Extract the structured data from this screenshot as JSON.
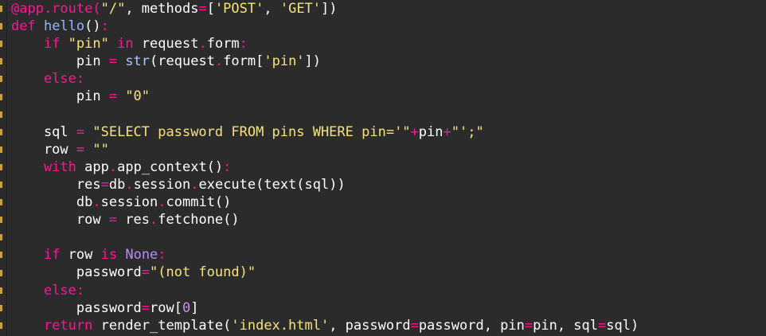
{
  "lines": [
    [
      {
        "cls": "dec",
        "t": "@app.route("
      },
      {
        "cls": "str",
        "t": "\"/\""
      },
      {
        "cls": "plain",
        "t": ", methods"
      },
      {
        "cls": "op",
        "t": "="
      },
      {
        "cls": "plain",
        "t": "["
      },
      {
        "cls": "str",
        "t": "'POST'"
      },
      {
        "cls": "plain",
        "t": ", "
      },
      {
        "cls": "str",
        "t": "'GET'"
      },
      {
        "cls": "plain",
        "t": "])"
      }
    ],
    [
      {
        "cls": "kw",
        "t": "def "
      },
      {
        "cls": "fn",
        "t": "hello"
      },
      {
        "cls": "plain",
        "t": "()"
      },
      {
        "cls": "op",
        "t": ":"
      }
    ],
    [
      {
        "cls": "plain",
        "t": "    "
      },
      {
        "cls": "kw",
        "t": "if "
      },
      {
        "cls": "str",
        "t": "\"pin\""
      },
      {
        "cls": "kw",
        "t": " in "
      },
      {
        "cls": "plain",
        "t": "request"
      },
      {
        "cls": "op",
        "t": "."
      },
      {
        "cls": "plain",
        "t": "form"
      },
      {
        "cls": "op",
        "t": ":"
      }
    ],
    [
      {
        "cls": "plain",
        "t": "        pin "
      },
      {
        "cls": "op",
        "t": "="
      },
      {
        "cls": "bi",
        "t": " str"
      },
      {
        "cls": "plain",
        "t": "(request"
      },
      {
        "cls": "op",
        "t": "."
      },
      {
        "cls": "plain",
        "t": "form["
      },
      {
        "cls": "str",
        "t": "'pin'"
      },
      {
        "cls": "plain",
        "t": "])"
      }
    ],
    [
      {
        "cls": "plain",
        "t": "    "
      },
      {
        "cls": "kw",
        "t": "else"
      },
      {
        "cls": "op",
        "t": ":"
      }
    ],
    [
      {
        "cls": "plain",
        "t": "        pin "
      },
      {
        "cls": "op",
        "t": "="
      },
      {
        "cls": "str",
        "t": " \"0\""
      }
    ],
    [],
    [
      {
        "cls": "plain",
        "t": "    sql "
      },
      {
        "cls": "op",
        "t": "="
      },
      {
        "cls": "str",
        "t": " \"SELECT password FROM pins WHERE pin='\""
      },
      {
        "cls": "op",
        "t": "+"
      },
      {
        "cls": "plain",
        "t": "pin"
      },
      {
        "cls": "op",
        "t": "+"
      },
      {
        "cls": "str",
        "t": "\"';\""
      }
    ],
    [
      {
        "cls": "plain",
        "t": "    row "
      },
      {
        "cls": "op",
        "t": "="
      },
      {
        "cls": "str",
        "t": " \"\""
      }
    ],
    [
      {
        "cls": "plain",
        "t": "    "
      },
      {
        "cls": "kw",
        "t": "with"
      },
      {
        "cls": "plain",
        "t": " app"
      },
      {
        "cls": "op",
        "t": "."
      },
      {
        "cls": "plain",
        "t": "app_context()"
      },
      {
        "cls": "op",
        "t": ":"
      }
    ],
    [
      {
        "cls": "plain",
        "t": "        res"
      },
      {
        "cls": "op",
        "t": "="
      },
      {
        "cls": "plain",
        "t": "db"
      },
      {
        "cls": "op",
        "t": "."
      },
      {
        "cls": "plain",
        "t": "session"
      },
      {
        "cls": "op",
        "t": "."
      },
      {
        "cls": "plain",
        "t": "execute(text(sql))"
      }
    ],
    [
      {
        "cls": "plain",
        "t": "        db"
      },
      {
        "cls": "op",
        "t": "."
      },
      {
        "cls": "plain",
        "t": "session"
      },
      {
        "cls": "op",
        "t": "."
      },
      {
        "cls": "plain",
        "t": "commit()"
      }
    ],
    [
      {
        "cls": "plain",
        "t": "        row "
      },
      {
        "cls": "op",
        "t": "="
      },
      {
        "cls": "plain",
        "t": " res"
      },
      {
        "cls": "op",
        "t": "."
      },
      {
        "cls": "plain",
        "t": "fetchone()"
      }
    ],
    [],
    [
      {
        "cls": "plain",
        "t": "    "
      },
      {
        "cls": "kw",
        "t": "if"
      },
      {
        "cls": "plain",
        "t": " row "
      },
      {
        "cls": "kw",
        "t": "is"
      },
      {
        "cls": "const",
        "t": " None"
      },
      {
        "cls": "op",
        "t": ":"
      }
    ],
    [
      {
        "cls": "plain",
        "t": "        password"
      },
      {
        "cls": "op",
        "t": "="
      },
      {
        "cls": "str",
        "t": "\"(not found)\""
      }
    ],
    [
      {
        "cls": "plain",
        "t": "    "
      },
      {
        "cls": "kw",
        "t": "else"
      },
      {
        "cls": "op",
        "t": ":"
      }
    ],
    [
      {
        "cls": "plain",
        "t": "        password"
      },
      {
        "cls": "op",
        "t": "="
      },
      {
        "cls": "plain",
        "t": "row["
      },
      {
        "cls": "num",
        "t": "0"
      },
      {
        "cls": "plain",
        "t": "]"
      }
    ],
    [
      {
        "cls": "plain",
        "t": "    "
      },
      {
        "cls": "kw",
        "t": "return"
      },
      {
        "cls": "plain",
        "t": " render_template("
      },
      {
        "cls": "str",
        "t": "'index.html'"
      },
      {
        "cls": "plain",
        "t": ", password"
      },
      {
        "cls": "op",
        "t": "="
      },
      {
        "cls": "plain",
        "t": "password, pin"
      },
      {
        "cls": "op",
        "t": "="
      },
      {
        "cls": "plain",
        "t": "pin, sql"
      },
      {
        "cls": "op",
        "t": "="
      },
      {
        "cls": "plain",
        "t": "sql)"
      }
    ]
  ],
  "colors": {
    "background": "#2b2b2b",
    "keyword": "#ff1493",
    "string": "#f6e27a",
    "function": "#8fb7ff",
    "number": "#d08cf0",
    "gutter_mark": "#c7a243"
  }
}
